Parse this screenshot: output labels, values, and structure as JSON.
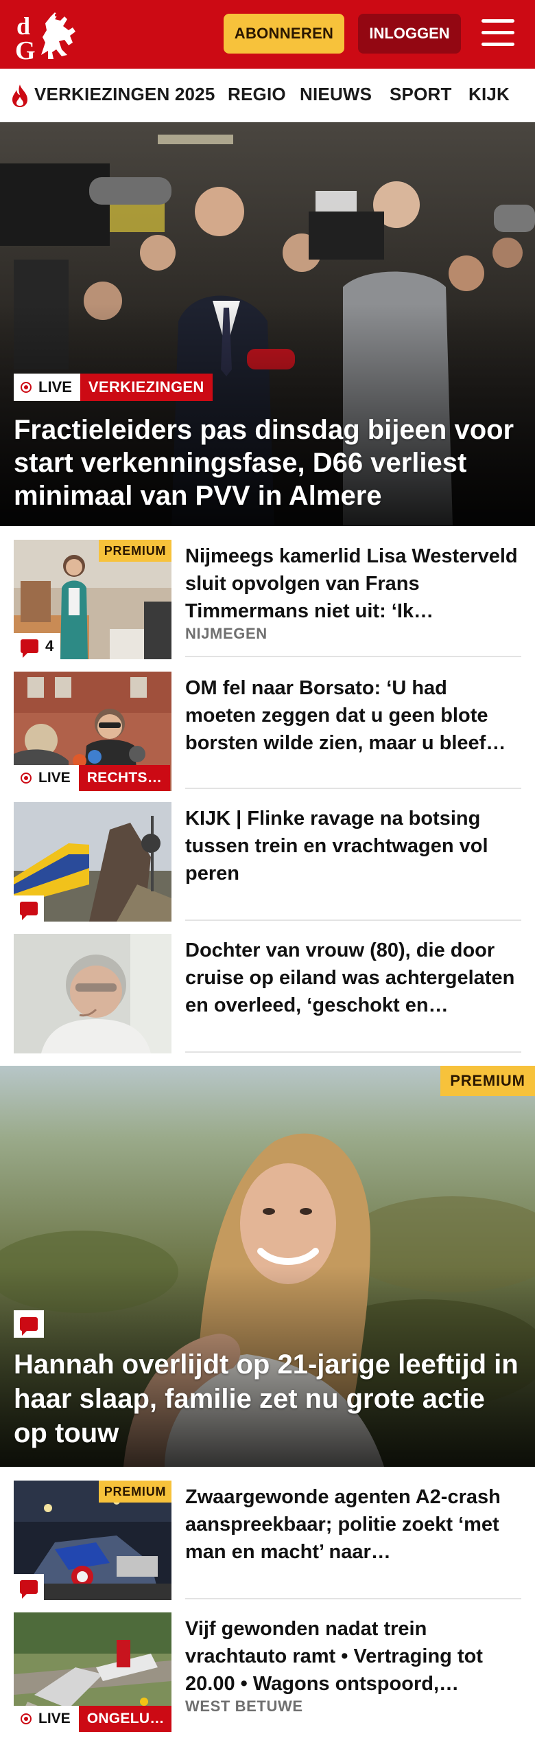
{
  "header": {
    "logo_letters": "dG",
    "subscribe_label": "ABONNEREN",
    "login_label": "INLOGGEN"
  },
  "nav": {
    "items": [
      {
        "label": "VERKIEZINGEN 2025"
      },
      {
        "label": "REGIO"
      },
      {
        "label": "NIEUWS"
      },
      {
        "label": "SPORT"
      },
      {
        "label": "KIJK"
      }
    ]
  },
  "hero": {
    "live_label": "LIVE",
    "category": "VERKIEZINGEN",
    "title": "Fractieleiders pas dinsdag bijeen voor start verkenningsfase, D66 verliest minimaal van PVV in Almere"
  },
  "articles": [
    {
      "title": "Nijmeegs kamerlid Lisa Westerveld sluit opvolgen van Frans Timmermans niet uit: ‘Ik…",
      "region": "NIJMEGEN",
      "premium_label": "PREMIUM",
      "comment_count": "4"
    },
    {
      "title": "OM fel naar Borsato: ‘U had moeten zeggen dat u geen blote borsten wilde zien, maar u bleef…",
      "live_label": "LIVE",
      "category": "RECHTS…"
    },
    {
      "title": "KIJK | Flinke ravage na botsing tussen trein en vrachtwagen vol peren"
    },
    {
      "title": "Dochter van vrouw (80), die door cruise op eiland was achtergela­ten en overleed, ‘geschokt en…"
    }
  ],
  "feature": {
    "premium_label": "PREMIUM",
    "title": "Hannah overlijdt op 21-jarige leeftijd in haar slaap, familie zet nu grote actie op touw"
  },
  "articles_2": [
    {
      "title": "Zwaargewonde agenten A2-crash aanspreekbaar; politie zoekt ‘met man en macht’ naar…",
      "premium_label": "PREMIUM"
    },
    {
      "title": "Vijf gewonden nadat trein vrachtauto ramt • Vertraging tot 20.00 • Wagons ontspoord,…",
      "region": "WEST BETUWE",
      "live_label": "LIVE",
      "category": "ONGELU…"
    }
  ],
  "colors": {
    "brand_red": "#cc0a14",
    "login_dark_red": "#930712",
    "premium_yellow": "#f7c23b",
    "region_gray": "#6f6f6f"
  },
  "icons": {
    "menu": "hamburger-icon",
    "nav_flame": "flame-icon",
    "comment": "comment-bubble-icon",
    "live": "live-dot-icon"
  }
}
